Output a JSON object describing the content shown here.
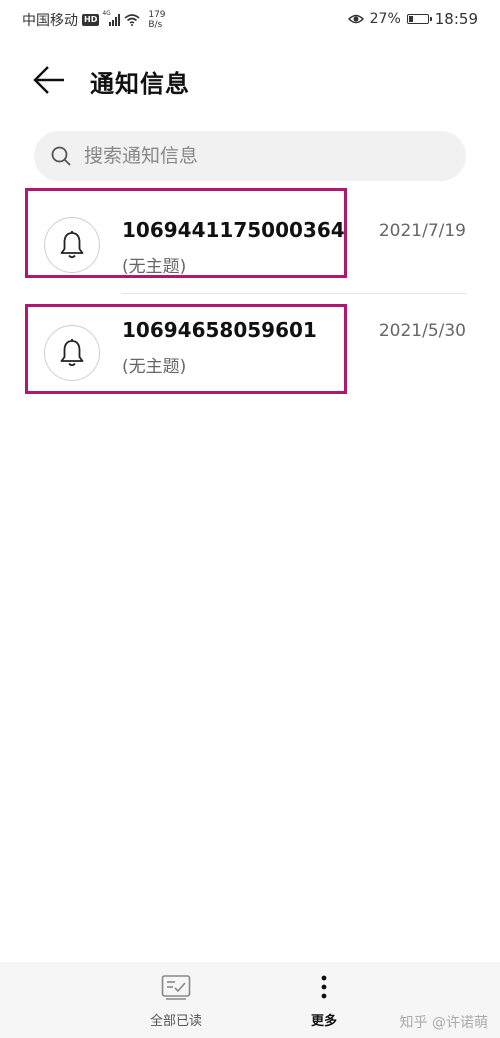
{
  "status_bar": {
    "carrier": "中国移动",
    "hd_badge": "HD",
    "network": "4G",
    "speed_value": "179",
    "speed_unit": "B/s",
    "battery_pct": "27%",
    "battery_level": 0.27,
    "time": "18:59"
  },
  "header": {
    "title": "通知信息"
  },
  "search": {
    "placeholder": "搜索通知信息"
  },
  "notifications": [
    {
      "sender": "1069441175000364",
      "subject": "(无主题)",
      "date": "2021/7/19"
    },
    {
      "sender": "10694658059601",
      "subject": "(无主题)",
      "date": "2021/5/30"
    }
  ],
  "bottom_bar": {
    "mark_all_read": "全部已读",
    "more": "更多"
  },
  "watermark": "知乎 @许诺萌",
  "colors": {
    "highlight": "#b0176e",
    "search_bg": "#f1f1f1",
    "bottom_bar_bg": "#f6f6f6"
  }
}
